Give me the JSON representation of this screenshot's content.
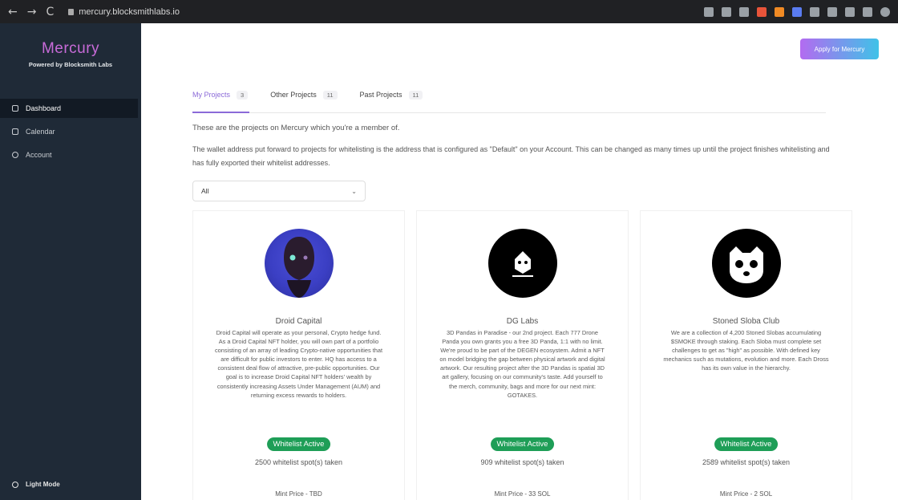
{
  "browser": {
    "url": "mercury.blocksmithlabs.io",
    "nav_back": "←",
    "nav_forward": "→",
    "nav_reload": "C"
  },
  "sidebar": {
    "brand_name": "Mercury",
    "brand_sub": "Powered by Blocksmith Labs",
    "items": [
      {
        "label": "Dashboard",
        "icon": "home-icon",
        "active": true
      },
      {
        "label": "Calendar",
        "icon": "calendar-icon",
        "active": false
      },
      {
        "label": "Account",
        "icon": "user-icon",
        "active": false
      }
    ],
    "light_mode_label": "Light Mode"
  },
  "header": {
    "apply_label": "Apply for Mercury"
  },
  "tabs": [
    {
      "label": "My Projects",
      "count": "3",
      "active": true
    },
    {
      "label": "Other Projects",
      "count": "11",
      "active": false
    },
    {
      "label": "Past Projects",
      "count": "11",
      "active": false
    }
  ],
  "intro_text": "These are the projects on Mercury which you're a member of.",
  "description_text": "The wallet address put forward to projects for whitelisting is the address that is configured as \"Default\" on your Account. This can be changed as many times up until the project finishes whitelisting and has fully exported their whitelist addresses.",
  "filter": {
    "selected": "All"
  },
  "cards": [
    {
      "title": "Droid Capital",
      "description": "Droid Capital will operate as your personal, Crypto hedge fund. As a Droid Capital NFT holder, you will own part of a portfolio consisting of an array of leading Crypto-native opportunities that are difficult for public investors to enter. HQ has access to a consistent deal flow of attractive, pre-public opportunities. Our goal is to increase Droid Capital NFT holders' wealth by consistently increasing Assets Under Management (AUM) and returning excess rewards to holders.",
      "badge": "Whitelist Active",
      "spots": "2500 whitelist spot(s) taken",
      "mint": "Mint Price - TBD",
      "avatar_colors": [
        "#3b3fc4",
        "#2c1f3c"
      ]
    },
    {
      "title": "DG Labs",
      "description": "3D Pandas in Paradise - our 2nd project. Each 777 Drone Panda you own grants you a free 3D Panda, 1:1 with no limit. We're proud to be part of the DEGEN ecosystem. Admit a NFT on model bridging the gap between physical artwork and digital artwork. Our resulting project after the 3D Pandas is spatial 3D art gallery, focusing on our community's taste. Add yourself to the merch, community, bags and more for our next mint: GOTAKES.",
      "badge": "Whitelist Active",
      "spots": "909 whitelist spot(s) taken",
      "mint": "Mint Price - 33 SOL",
      "avatar_colors": [
        "#000000",
        "#ffffff"
      ]
    },
    {
      "title": "Stoned Sloba Club",
      "description": "We are a collection of 4,200 Stoned Slobas accumulating $SMOKE through staking. Each Sloba must complete set challenges to get as \"high\" as possible. With defined key mechanics such as mutations, evolution and more. Each Dross has its own value in the hierarchy.",
      "badge": "Whitelist Active",
      "spots": "2589 whitelist spot(s) taken",
      "mint": "Mint Price - 2 SOL",
      "avatar_colors": [
        "#000000",
        "#ffffff"
      ]
    }
  ]
}
